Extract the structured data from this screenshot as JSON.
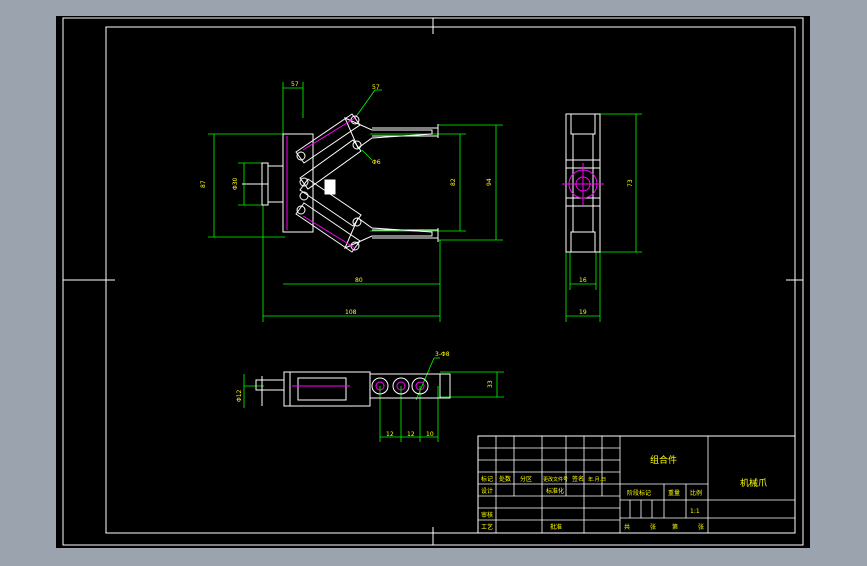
{
  "drawing": {
    "colors": {
      "background": "#9aa3ae",
      "paper": "#000000",
      "border": "#ffffff",
      "dimension": "#00ff00",
      "part_outline": "#ffffff",
      "center_mark": "#ff00ff",
      "title_text": "#ffff00"
    },
    "dimensions": {
      "front_top": "57",
      "front_link_upper": "57",
      "front_pin": "Φ6",
      "front_left_height": "87",
      "front_cylinder": "Φ30",
      "front_inner_span": "82",
      "front_outer_span": "94",
      "front_width": "80",
      "front_total_length": "108",
      "side_height": "73",
      "side_lower_width": "16",
      "side_base_width": "19",
      "top_holes_note": "3-Φ8",
      "top_rod": "Φ12",
      "top_jaw_height": "33",
      "top_pitch_a": "12",
      "top_pitch_b": "12",
      "top_pitch_c": "10"
    },
    "title_block": {
      "assembly_label": "组合件",
      "drawing_name": "机械爪",
      "row_headers": [
        "标记",
        "处数",
        "分区",
        "更改文件号",
        "签名",
        "年.月.日"
      ],
      "design": "设计",
      "standardize": "标准化",
      "review": "审核",
      "process": "工艺",
      "approve": "批准",
      "stage_mark": "阶段标记",
      "weight": "重量",
      "scale_label": "比例",
      "scale_value": "1:1",
      "sheets_total": "共",
      "sheets_unit_a": "张",
      "sheet_no": "第",
      "sheets_unit_b": "张"
    }
  }
}
